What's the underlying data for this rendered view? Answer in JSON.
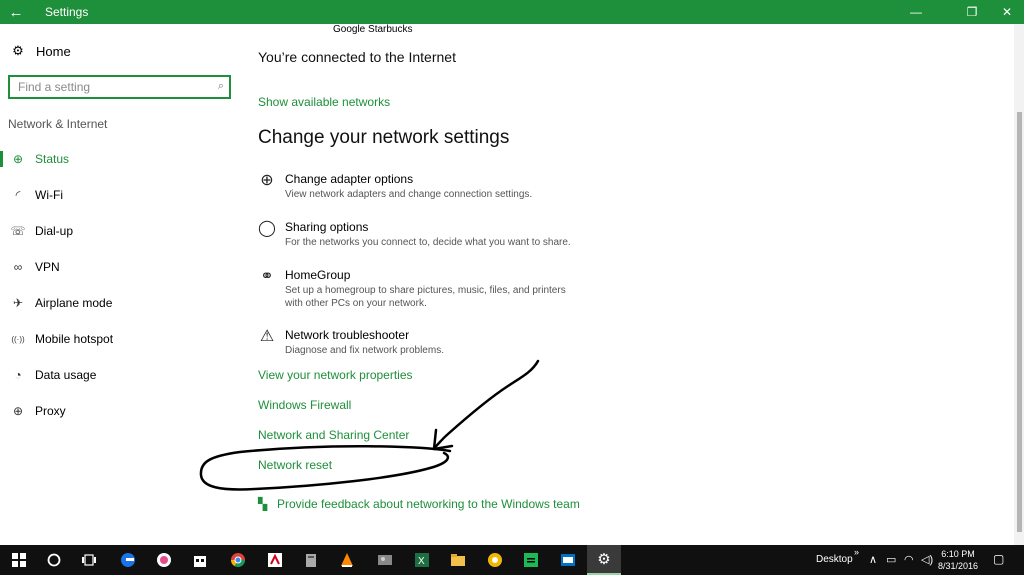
{
  "titlebar": {
    "title": "Settings",
    "back_icon": "←",
    "minimize_icon": "—",
    "maximize_icon": "❐",
    "close_icon": "✕",
    "accent": "#1e8f3a"
  },
  "sidebar": {
    "home_label": "Home",
    "home_icon": "⚙",
    "search_placeholder": "Find a setting",
    "search_icon": "⌕",
    "section_label": "Network & Internet",
    "items": [
      {
        "label": "Status",
        "icon": "⊕"
      },
      {
        "label": "Wi-Fi",
        "icon": "◜"
      },
      {
        "label": "Dial-up",
        "icon": "☏"
      },
      {
        "label": "VPN",
        "icon": "∞"
      },
      {
        "label": "Airplane mode",
        "icon": "✈"
      },
      {
        "label": "Mobile hotspot",
        "icon": "((·))"
      },
      {
        "label": "Data usage",
        "icon": "◔"
      },
      {
        "label": "Proxy",
        "icon": "⊕"
      }
    ]
  },
  "main": {
    "network_name": "Google Starbucks",
    "connected_text": "You’re connected to the Internet",
    "show_networks": "Show available networks",
    "heading": "Change your network settings",
    "options": [
      {
        "title": "Change adapter options",
        "desc": "View network adapters and change connection settings.",
        "icon": "⊕"
      },
      {
        "title": "Sharing options",
        "desc": "For the networks you connect to, decide what you want to share.",
        "icon": "◯"
      },
      {
        "title": "HomeGroup",
        "desc": "Set up a homegroup to share pictures, music, files, and printers with other PCs on your network.",
        "icon": "⚭"
      },
      {
        "title": "Network troubleshooter",
        "desc": "Diagnose and fix network problems.",
        "icon": "⚠"
      }
    ],
    "links": {
      "properties": "View your network properties",
      "firewall": "Windows Firewall",
      "sharing_center": "Network and Sharing Center",
      "reset": "Network reset"
    },
    "feedback": "Provide feedback about networking to the Windows team",
    "feedback_icon": "▚"
  },
  "taskbar": {
    "apps": [
      "start",
      "search",
      "task-view",
      "edge",
      "itunes",
      "store",
      "chrome",
      "acrobat",
      "files",
      "vlc",
      "photos",
      "excel",
      "explorer",
      "norton",
      "spotify",
      "outlook",
      "settings"
    ],
    "desktop_label": "Desktop",
    "time": "6:10 PM",
    "date": "8/31/2016"
  }
}
